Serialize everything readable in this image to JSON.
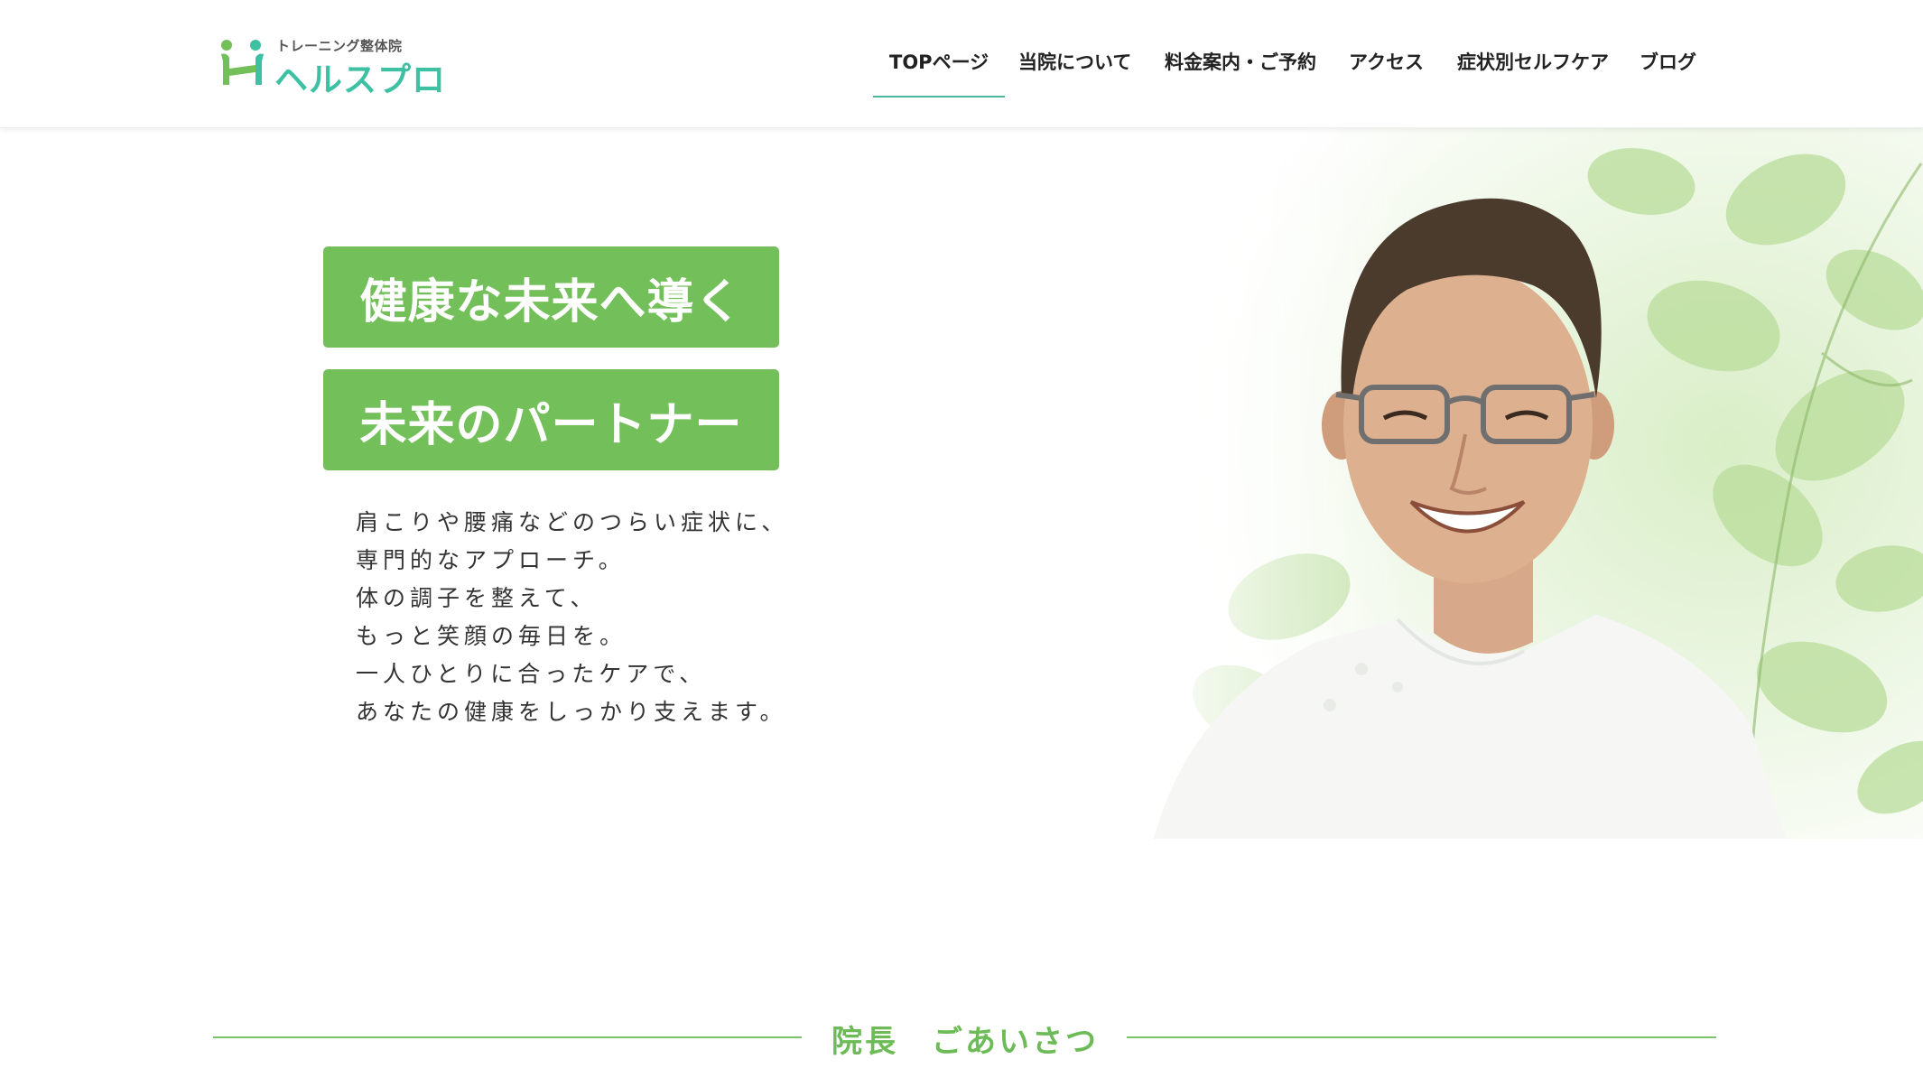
{
  "colors": {
    "accent_green": "#73bf5a",
    "heading_green": "#6dbb56",
    "nav_underline": "#4cb6a0",
    "logo_teal": "#3ec0a2"
  },
  "header": {
    "logo": {
      "small_text": "トレーニング整体院",
      "main_text": "ヘルスプロ",
      "icon": "person-h-logo-icon"
    },
    "nav": [
      {
        "label": "TOPページ",
        "active": true
      },
      {
        "label": "当院について",
        "active": false
      },
      {
        "label": "料金案内・ご予約",
        "active": false
      },
      {
        "label": "アクセス",
        "active": false
      },
      {
        "label": "症状別セルフケア",
        "active": false
      },
      {
        "label": "ブログ",
        "active": false
      }
    ]
  },
  "hero": {
    "headline_1": "健康な未来へ導く",
    "headline_2": "未来のパートナー",
    "body_lines": [
      "肩こりや腰痛などのつらい症状に、",
      "専門的なアプローチ。",
      "体の調子を整えて、",
      "もっと笑顔の毎日を。",
      "一人ひとりに合ったケアで、",
      "あなたの健康をしっかり支えます。"
    ]
  },
  "section": {
    "title": "院長　ごあいさつ"
  }
}
